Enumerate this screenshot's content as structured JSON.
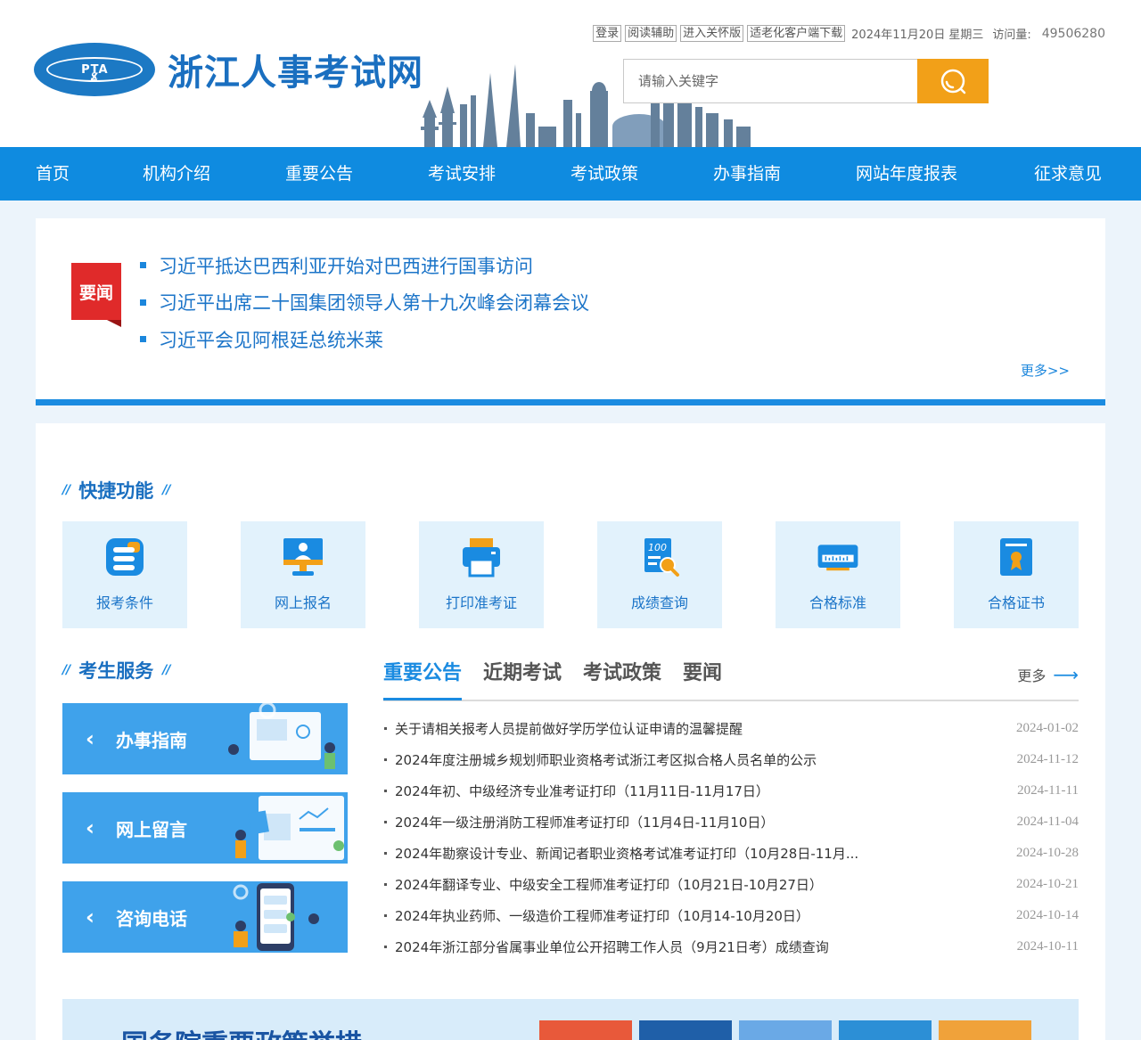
{
  "header": {
    "logo_text": "PTA",
    "site_title": "浙江人事考试网",
    "top_links": [
      "登录",
      "阅读辅助",
      "进入关怀版",
      "适老化客户端下载"
    ],
    "date": "2024年11月20日",
    "weekday": "星期三",
    "visits_label": "访问量:",
    "visits_count": "49506280",
    "search_placeholder": "请输入关键字"
  },
  "nav": {
    "items": [
      "首页",
      "机构介绍",
      "重要公告",
      "考试安排",
      "考试政策",
      "办事指南",
      "网站年度报表",
      "征求意见"
    ]
  },
  "news": {
    "tag": "要闻",
    "items": [
      "习近平抵达巴西利亚开始对巴西进行国事访问",
      "习近平出席二十国集团领导人第十九次峰会闭幕会议",
      "习近平会见阿根廷总统米莱"
    ],
    "more": "更多>>"
  },
  "quick": {
    "title": "快捷功能",
    "items": [
      {
        "label": "报考条件",
        "icon": "exam-conditions-icon"
      },
      {
        "label": "网上报名",
        "icon": "online-registration-icon"
      },
      {
        "label": "打印准考证",
        "icon": "printer-icon"
      },
      {
        "label": "成绩查询",
        "icon": "score-search-icon"
      },
      {
        "label": "合格标准",
        "icon": "ruler-icon"
      },
      {
        "label": "合格证书",
        "icon": "certificate-icon"
      }
    ]
  },
  "services": {
    "title": "考生服务",
    "items": [
      "办事指南",
      "网上留言",
      "咨询电话"
    ]
  },
  "tabs": {
    "items": [
      "重要公告",
      "近期考试",
      "考试政策",
      "要闻"
    ],
    "active": 0,
    "more": "更多"
  },
  "announcements": [
    {
      "title": "关于请相关报考人员提前做好学历学位认证申请的温馨提醒",
      "date": "2024-01-02"
    },
    {
      "title": "2024年度注册城乡规划师职业资格考试浙江考区拟合格人员名单的公示",
      "date": "2024-11-12"
    },
    {
      "title": "2024年初、中级经济专业准考证打印（11月11日-11月17日）",
      "date": "2024-11-11"
    },
    {
      "title": "2024年一级注册消防工程师准考证打印（11月4日-11月10日）",
      "date": "2024-11-04"
    },
    {
      "title": "2024年勘察设计专业、新闻记者职业资格考试准考证打印（10月28日-11月...",
      "date": "2024-10-28"
    },
    {
      "title": "2024年翻译专业、中级安全工程师准考证打印（10月21日-10月27日）",
      "date": "2024-10-21"
    },
    {
      "title": "2024年执业药师、一级造价工程师准考证打印（10月14-10月20日）",
      "date": "2024-10-14"
    },
    {
      "title": "2024年浙江部分省属事业单位公开招聘工作人员（9月21日考）成绩查询",
      "date": "2024-10-11"
    }
  ],
  "banner": {
    "title": "国务院重要政策举措"
  },
  "colors": {
    "brand": "#1a8be1",
    "nav": "#0f8be0",
    "accent": "#f2a018",
    "tag_red": "#e02a2a"
  }
}
